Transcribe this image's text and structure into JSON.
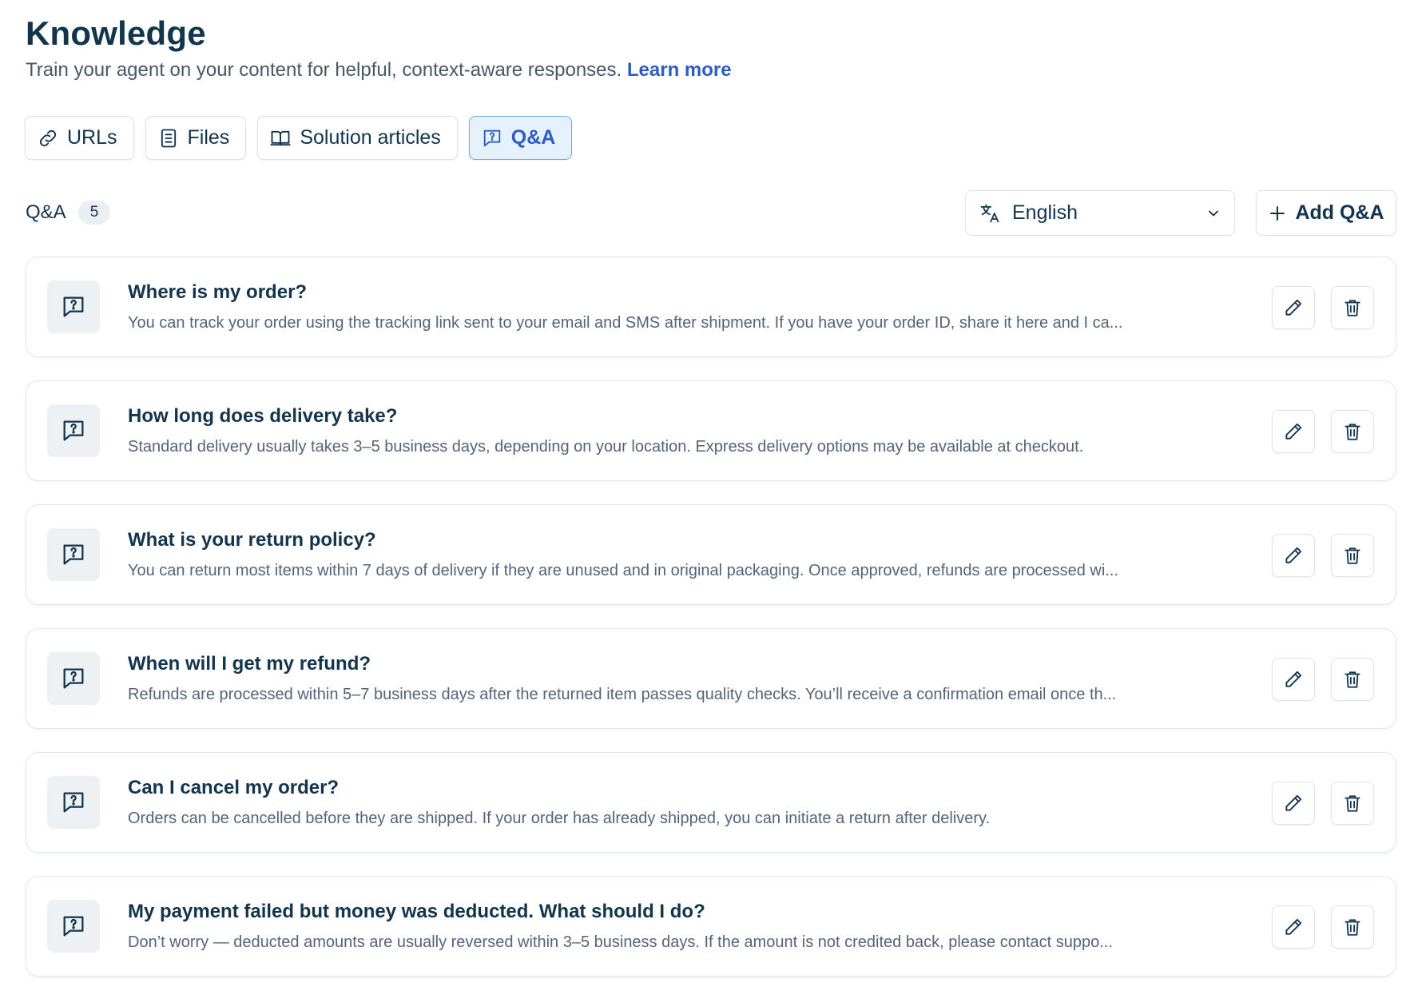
{
  "header": {
    "title": "Knowledge",
    "subtitle": "Train your agent on your content for helpful, context-aware responses.",
    "learn_more": "Learn more"
  },
  "tabs": [
    {
      "label": "URLs",
      "icon": "link-icon",
      "active": false
    },
    {
      "label": "Files",
      "icon": "file-icon",
      "active": false
    },
    {
      "label": "Solution articles",
      "icon": "book-icon",
      "active": false
    },
    {
      "label": "Q&A",
      "icon": "question-chat-icon",
      "active": true
    }
  ],
  "list": {
    "label": "Q&A",
    "count": "5",
    "language": "English",
    "add_label": "Add Q&A"
  },
  "items": [
    {
      "question": "Where is my order?",
      "answer": "You can track your order using the tracking link sent to your email and SMS after shipment. If you have your order ID, share it here and I ca..."
    },
    {
      "question": "How long does delivery take?",
      "answer": "Standard delivery usually takes 3–5 business days, depending on your location. Express delivery options may be available at checkout."
    },
    {
      "question": "What is your return policy?",
      "answer": "You can return most items within 7 days of delivery if they are unused and in original packaging. Once approved, refunds are processed wi..."
    },
    {
      "question": "When will I get my refund?",
      "answer": "Refunds are processed within 5–7 business days after the returned item passes quality checks. You’ll receive a confirmation email once th..."
    },
    {
      "question": "Can I cancel my order?",
      "answer": "Orders can be cancelled before they are shipped. If your order has already shipped, you can initiate a return after delivery."
    },
    {
      "question": "My payment failed but money was deducted. What should I do?",
      "answer": "Don’t worry — deducted amounts are usually reversed within 3–5 business days. If the amount is not credited back, please contact suppo..."
    }
  ],
  "colors": {
    "text_primary": "#12344d",
    "text_secondary": "#53657a",
    "link": "#2c5cc5",
    "active_tab_bg": "#e5f2fd",
    "active_tab_border": "#62aef0"
  }
}
